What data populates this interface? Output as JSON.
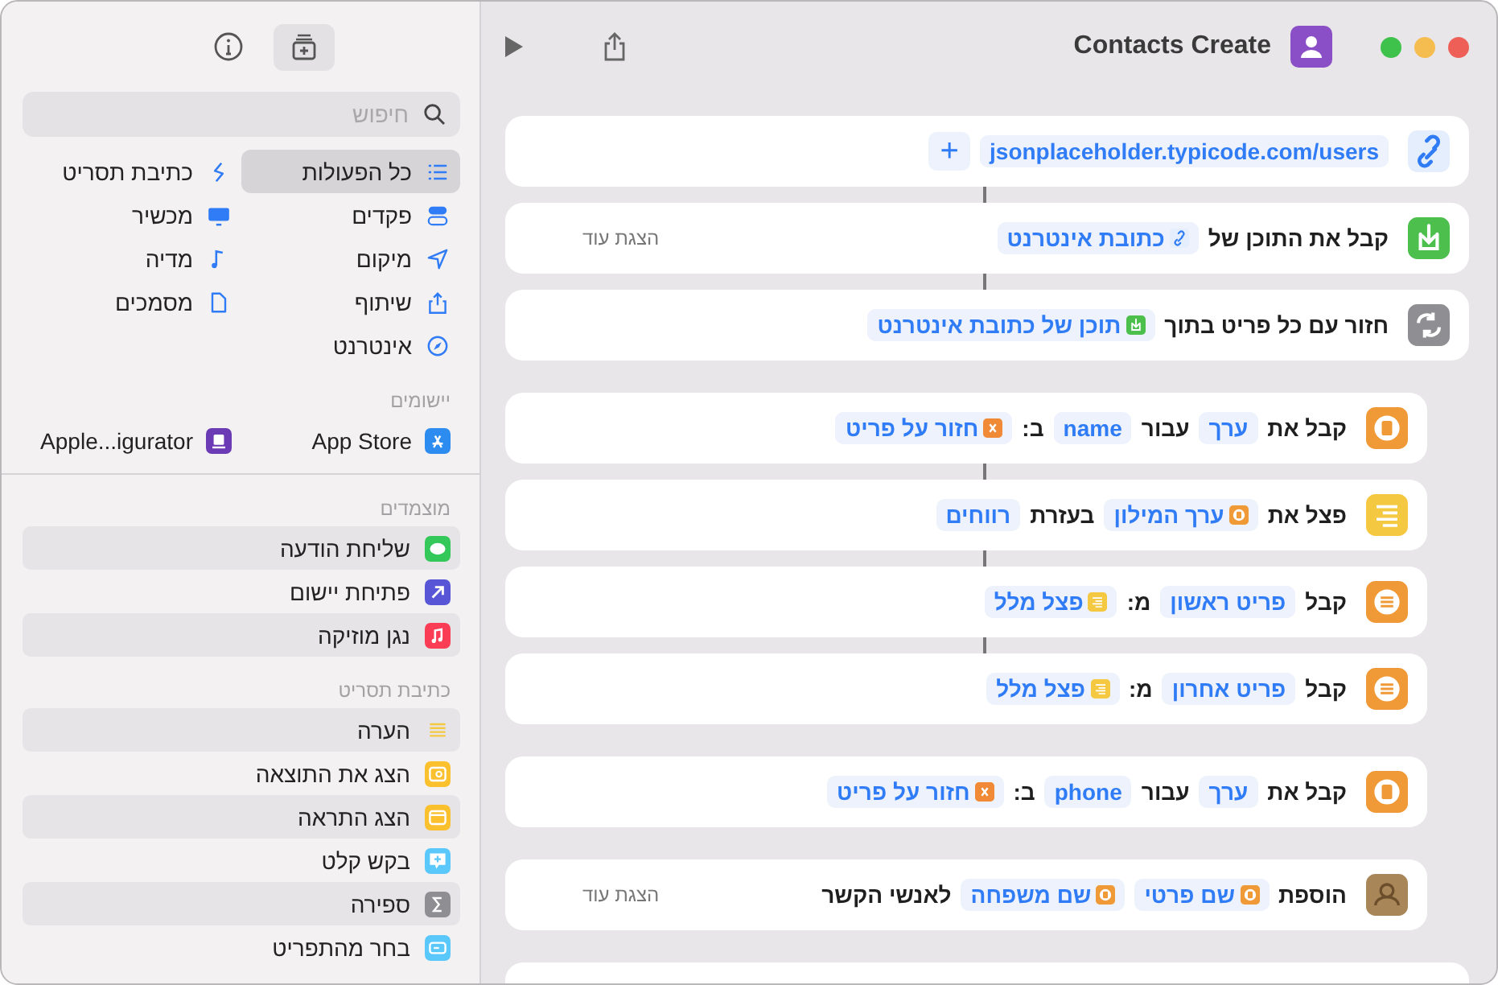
{
  "window": {
    "title": "Contacts Create"
  },
  "sidebar": {
    "search": {
      "placeholder": "חיפוש"
    },
    "categories": [
      {
        "label": "כל הפעולות",
        "selected": true
      },
      {
        "label": "כתיבת תסריט",
        "selected": false
      },
      {
        "label": "פקדים",
        "selected": false
      },
      {
        "label": "מכשיר",
        "selected": false
      },
      {
        "label": "מיקום",
        "selected": false
      },
      {
        "label": "מדיה",
        "selected": false
      },
      {
        "label": "שיתוף",
        "selected": false
      },
      {
        "label": "מסמכים",
        "selected": false
      },
      {
        "label": "אינטרנט",
        "selected": false
      }
    ],
    "apps_header": "יישומים",
    "apps": [
      "App Store",
      "Apple...igurator"
    ],
    "sections": [
      {
        "header": "מוצמדים",
        "items": [
          "שליחת הודעה",
          "פתיחת יישום",
          "נגן מוזיקה"
        ]
      },
      {
        "header": "כתיבת תסריט",
        "items": [
          "הערה",
          "הצג את התוצאה",
          "הצג התראה",
          "בקש קלט",
          "ספירה",
          "בחר מהתפריט"
        ]
      }
    ]
  },
  "actions": [
    {
      "kind": "link",
      "indent": false,
      "connector_above": false,
      "parts": [
        {
          "kind": "token",
          "text": "jsonplaceholder.typicode.com/users"
        },
        {
          "kind": "add",
          "text": "+"
        }
      ]
    },
    {
      "kind": "download",
      "indent": false,
      "connector_above": true,
      "show_more": "הצגת עוד",
      "parts": [
        {
          "kind": "text",
          "text": "קבל את התוכן של"
        },
        {
          "kind": "link-token",
          "text": "כתובת אינטרנט"
        }
      ]
    },
    {
      "kind": "repeat",
      "indent": false,
      "connector_above": true,
      "parts": [
        {
          "kind": "text",
          "text": "חזור עם כל פריט בתוך"
        },
        {
          "kind": "download-token",
          "text": "תוכן של כתובת אינטרנט"
        }
      ]
    },
    {
      "kind": "dictionary",
      "indent": true,
      "connector_above": false,
      "parts": [
        {
          "kind": "text",
          "text": "קבל את"
        },
        {
          "kind": "token",
          "text": "ערך"
        },
        {
          "kind": "text",
          "text": "עבור"
        },
        {
          "kind": "token",
          "text": "name"
        },
        {
          "kind": "text",
          "text": "ב:"
        },
        {
          "kind": "variable-token",
          "text": "חזור על פריט"
        }
      ]
    },
    {
      "kind": "split",
      "indent": true,
      "connector_above": true,
      "parts": [
        {
          "kind": "text",
          "text": "פצל את"
        },
        {
          "kind": "dictionary-token",
          "text": "ערך המילון"
        },
        {
          "kind": "text",
          "text": "בעזרת"
        },
        {
          "kind": "token",
          "text": "רווחים"
        }
      ]
    },
    {
      "kind": "list",
      "indent": true,
      "connector_above": true,
      "parts": [
        {
          "kind": "text",
          "text": "קבל"
        },
        {
          "kind": "token",
          "text": "פריט ראשון"
        },
        {
          "kind": "text",
          "text": "מ:"
        },
        {
          "kind": "split-token",
          "text": "פצל מלל"
        }
      ]
    },
    {
      "kind": "list",
      "indent": true,
      "connector_above": true,
      "parts": [
        {
          "kind": "text",
          "text": "קבל"
        },
        {
          "kind": "token",
          "text": "פריט אחרון"
        },
        {
          "kind": "text",
          "text": "מ:"
        },
        {
          "kind": "split-token",
          "text": "פצל מלל"
        }
      ]
    },
    {
      "kind": "dictionary",
      "indent": true,
      "connector_above": false,
      "parts": [
        {
          "kind": "text",
          "text": "קבל את"
        },
        {
          "kind": "token",
          "text": "ערך"
        },
        {
          "kind": "text",
          "text": "עבור"
        },
        {
          "kind": "token",
          "text": "phone"
        },
        {
          "kind": "text",
          "text": "ב:"
        },
        {
          "kind": "variable-token",
          "text": "חזור על פריט"
        }
      ]
    },
    {
      "kind": "contacts",
      "indent": true,
      "connector_above": false,
      "show_more": "הצגת עוד",
      "parts": [
        {
          "kind": "text",
          "text": "הוספת"
        },
        {
          "kind": "dictionary-token",
          "text": "שם פרטי"
        },
        {
          "kind": "dictionary-token",
          "text": "שם משפחה"
        },
        {
          "kind": "text",
          "text": "לאנשי הקשר"
        }
      ]
    },
    {
      "kind": "partial",
      "indent": false,
      "connector_above": false
    }
  ]
}
